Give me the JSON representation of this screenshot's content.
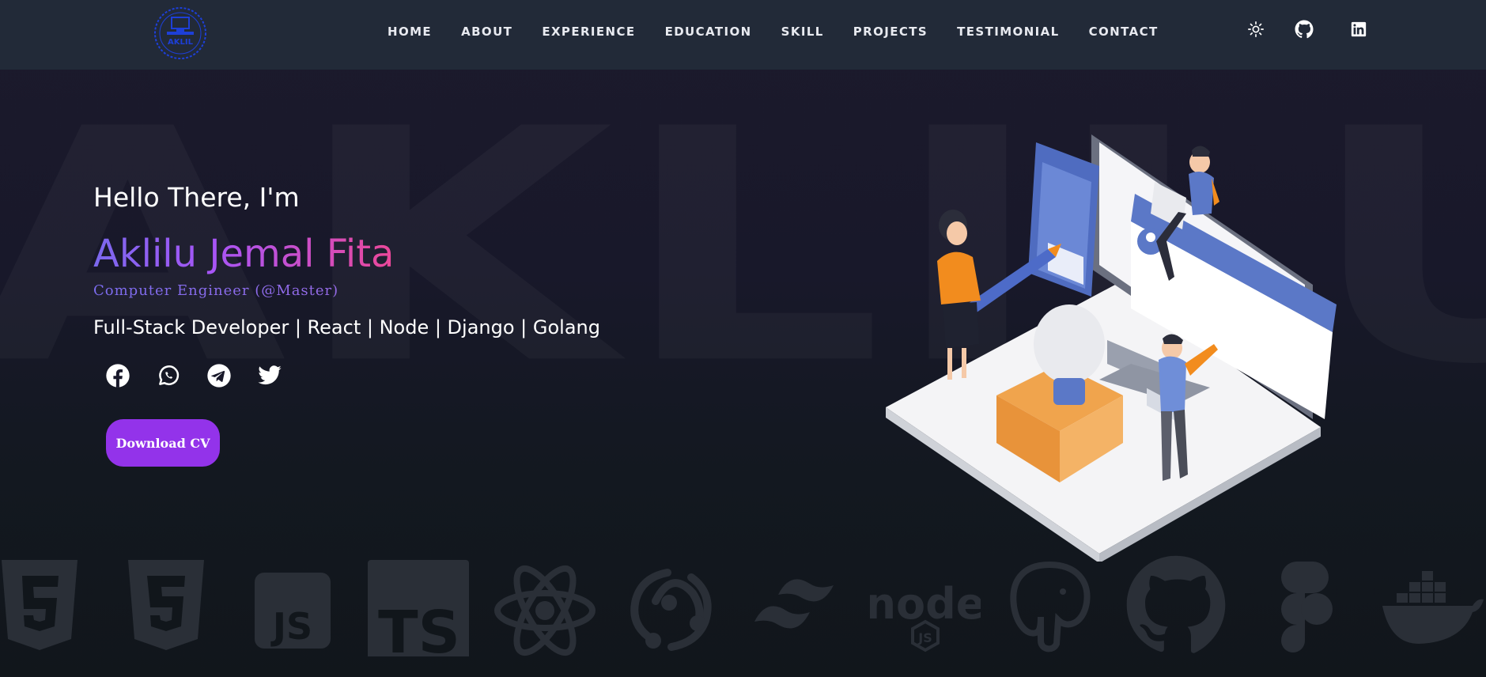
{
  "nav": {
    "logo_text": "AKLIL",
    "links": [
      "HOME",
      "ABOUT",
      "EXPERIENCE",
      "EDUCATION",
      "SKILL",
      "PROJECTS",
      "TESTIMONIAL",
      "CONTACT"
    ],
    "icons": [
      "sun-icon",
      "github-icon",
      "linkedin-icon"
    ]
  },
  "watermark": "AKLILU",
  "hero": {
    "greeting": "Hello There, I'm",
    "name": "Aklilu Jemal Fita",
    "degree": "Computer Engineer (@Master)",
    "tagline": "Full-Stack Developer | React | Node | Django | Golang",
    "socials": [
      "facebook-icon",
      "whatsapp-icon",
      "telegram-icon",
      "twitter-icon"
    ],
    "download_label": "Download CV"
  },
  "tech_icons": [
    "html5-icon",
    "css3-icon",
    "javascript-icon",
    "typescript-icon",
    "react-icon",
    "redux-icon",
    "tailwind-icon",
    "nodejs-icon",
    "postgresql-icon",
    "github-icon",
    "figma-icon",
    "docker-icon"
  ],
  "tech_text": {
    "js": "JS",
    "ts": "TS",
    "node": "node"
  },
  "colors": {
    "nav_bg": "#222a38",
    "accent_purple": "#9333ea",
    "gradient_start": "#7b68ee",
    "gradient_end": "#ec4899",
    "icon_muted": "#2a2f37"
  }
}
